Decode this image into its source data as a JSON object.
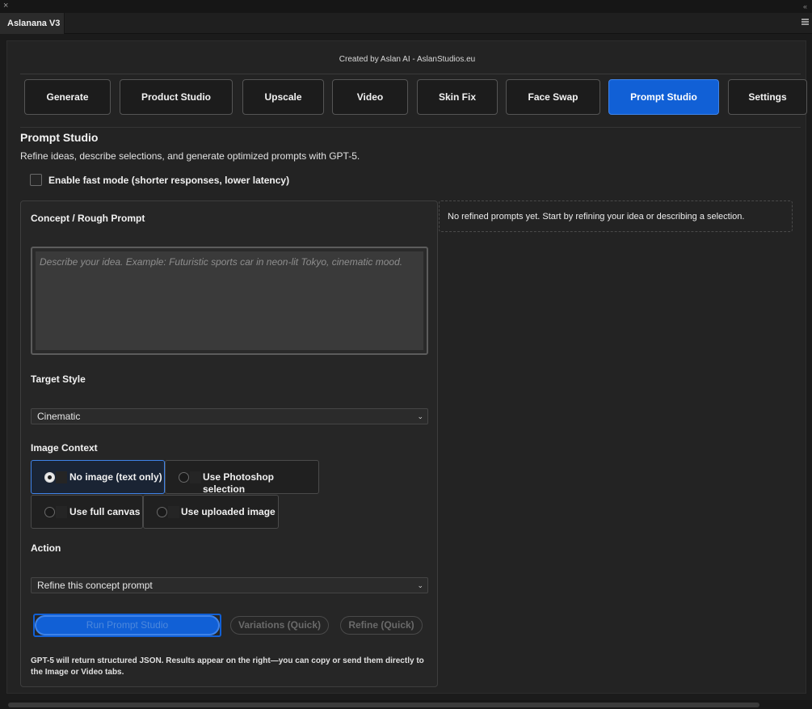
{
  "window": {
    "panel_title": "Aslanana V3"
  },
  "header": {
    "credit": "Created by Aslan AI - AslanStudios.eu"
  },
  "tabs": [
    {
      "label": "Generate"
    },
    {
      "label": "Product Studio"
    },
    {
      "label": "Upscale"
    },
    {
      "label": "Video"
    },
    {
      "label": "Skin Fix"
    },
    {
      "label": "Face Swap"
    },
    {
      "label": "Prompt Studio",
      "active": true
    },
    {
      "label": "Settings"
    }
  ],
  "page": {
    "title": "Prompt Studio",
    "description": "Refine ideas, describe selections, and generate optimized prompts with GPT-5.",
    "fast_mode_label": "Enable fast mode (shorter responses, lower latency)",
    "fast_mode_checked": false
  },
  "form": {
    "concept_label": "Concept / Rough Prompt",
    "concept_placeholder": "Describe your idea. Example: Futuristic sports car in neon-lit Tokyo, cinematic mood.",
    "concept_value": "",
    "style_label": "Target Style",
    "style_value": "Cinematic",
    "context_label": "Image Context",
    "context_options": [
      {
        "label": "No image (text only)",
        "selected": true
      },
      {
        "label": "Use Photoshop selection",
        "selected": false
      },
      {
        "label": "Use full canvas",
        "selected": false
      },
      {
        "label": "Use uploaded image",
        "selected": false
      }
    ],
    "action_label": "Action",
    "action_value": "Refine this concept prompt",
    "run_button": "Run Prompt Studio",
    "variations_button": "Variations (Quick)",
    "refine_button": "Refine (Quick)",
    "footnote": "GPT-5 will return structured JSON. Results appear on the right—you can copy or send them directly to the Image or Video tabs."
  },
  "results": {
    "empty_message": "No refined prompts yet. Start by refining your idea or describing a selection."
  },
  "icons": {
    "close": "close-icon",
    "collapse": "collapse-icon",
    "panel_menu": "menu-icon",
    "chevron": "chevron-down-icon"
  },
  "colors": {
    "accent": "#1160d6",
    "background": "#232323"
  }
}
